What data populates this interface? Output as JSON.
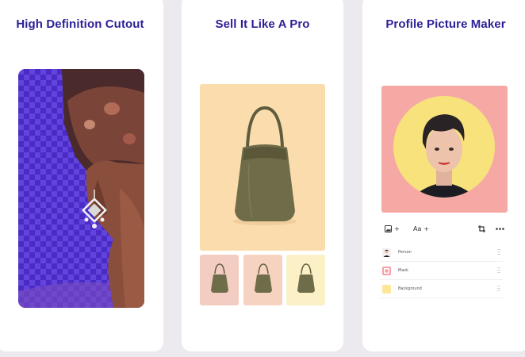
{
  "cards": [
    {
      "title": "High Definition Cutout"
    },
    {
      "title": "Sell It Like A Pro"
    },
    {
      "title": "Profile Picture Maker"
    }
  ],
  "toolbar": {
    "add_photo_icon": "image-plus-icon",
    "add_text_label": "Aa",
    "plus_symbol": "+",
    "crop_icon": "crop-icon",
    "more_icon": "more-icon"
  },
  "layers": [
    {
      "label": "Person"
    },
    {
      "label": "Mask"
    },
    {
      "label": "Background"
    }
  ],
  "colors": {
    "title": "#2c1f97",
    "cutout_bg": "#4d2fc9",
    "product_bg": "#fbdcad",
    "profile_bg": "#f6a8a5",
    "profile_circle": "#f8e27c",
    "mask_swatch": "#f6a0a6",
    "background_swatch": "#fde59a",
    "bag": "#6f6c4a"
  }
}
